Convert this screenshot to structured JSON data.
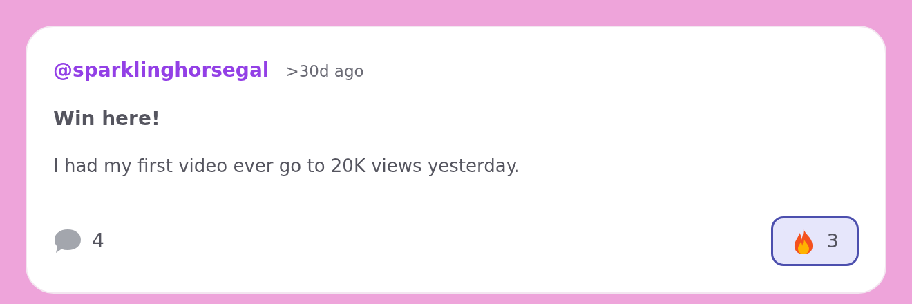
{
  "post": {
    "author": "@sparklinghorsegal",
    "time": ">30d ago",
    "title": "Win here!",
    "body": "I had my first video ever go to 20K views yesterday.",
    "comments": {
      "count": "4"
    },
    "reactions": [
      {
        "kind": "fire",
        "count": "3",
        "selected": true
      }
    ]
  }
}
